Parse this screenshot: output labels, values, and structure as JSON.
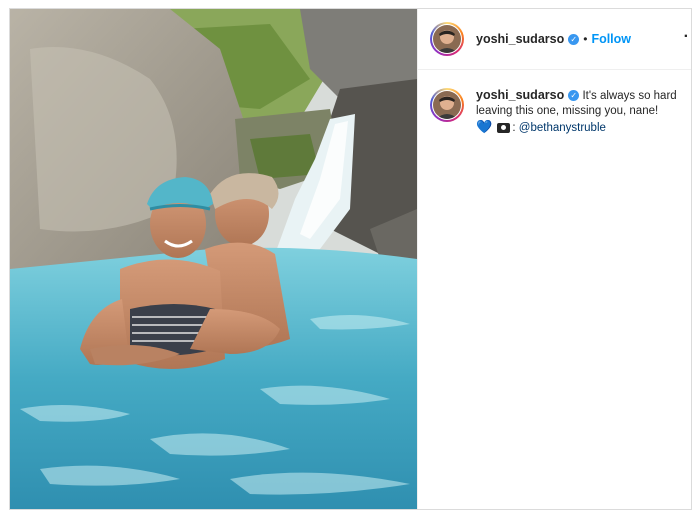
{
  "post": {
    "username": "yoshi_sudarso",
    "verified_icon": "verified-badge-icon",
    "separator": "•",
    "follow_label": "Follow",
    "more_label": "·",
    "caption": {
      "username": "yoshi_sudarso",
      "text": "It's always so hard leaving this one, missing you, nane!",
      "heart": "💙",
      "camera_icon": "camera-icon",
      "mention": "@bethanystruble"
    },
    "photo_alt": "Couple in turquoise river pool by a waterfall"
  },
  "colors": {
    "accent": "#0095f6",
    "verified": "#3897f0",
    "text": "#262626",
    "border": "#dbdbdb"
  }
}
